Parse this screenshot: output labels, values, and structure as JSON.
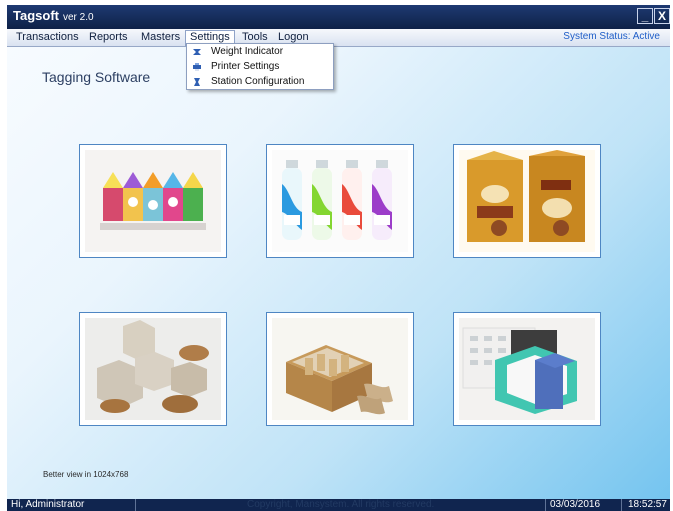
{
  "window": {
    "title": "Tagsoft",
    "version": "ver 2.0",
    "minimize_label": "_",
    "close_label": "X"
  },
  "menu": {
    "items": [
      {
        "label": "Transactions"
      },
      {
        "label": "Reports"
      },
      {
        "label": "Masters"
      },
      {
        "label": "Settings"
      },
      {
        "label": "Tools"
      },
      {
        "label": "Logon"
      }
    ],
    "active": "Settings",
    "system_status": "System Status: Active"
  },
  "settings_dropdown": [
    {
      "label": "Weight Indicator",
      "icon": "weight-indicator-icon"
    },
    {
      "label": "Printer Settings",
      "icon": "printer-icon"
    },
    {
      "label": "Station Configuration",
      "icon": "station-configuration-icon"
    }
  ],
  "content": {
    "heading": "Tagging Software",
    "view_hint": "Better view in 1024x768",
    "gallery": [
      {
        "image": "colorful-packaging-image"
      },
      {
        "image": "bottles-image"
      },
      {
        "image": "tea-boxes-image"
      },
      {
        "image": "packaging-boxes-image"
      },
      {
        "image": "cardboard-shipping-image"
      },
      {
        "image": "foam-packaging-image"
      }
    ]
  },
  "status_bar": {
    "user": "Hi, Administrator",
    "copyright": "Copyright, Mansystem. All rights reserved.",
    "date": "03/03/2016",
    "time": "18:52:57"
  },
  "colors": {
    "title_bar": "#0e2147",
    "accent": "#1f5ec8",
    "content_gradient_end": "#74c4ef"
  }
}
